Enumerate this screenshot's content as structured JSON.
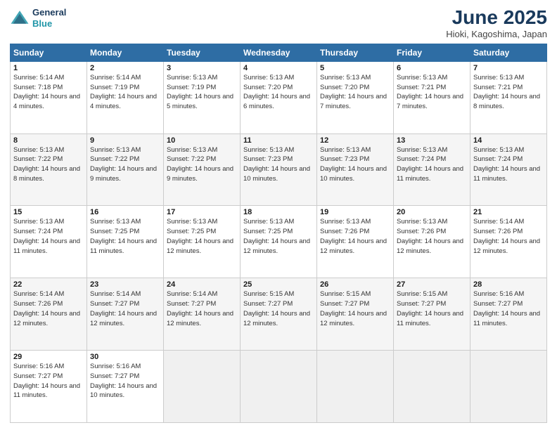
{
  "header": {
    "logo_line1": "General",
    "logo_line2": "Blue",
    "title": "June 2025",
    "location": "Hioki, Kagoshima, Japan"
  },
  "weekdays": [
    "Sunday",
    "Monday",
    "Tuesday",
    "Wednesday",
    "Thursday",
    "Friday",
    "Saturday"
  ],
  "weeks": [
    [
      {
        "day": "1",
        "sunrise": "Sunrise: 5:14 AM",
        "sunset": "Sunset: 7:18 PM",
        "daylight": "Daylight: 14 hours and 4 minutes."
      },
      {
        "day": "2",
        "sunrise": "Sunrise: 5:14 AM",
        "sunset": "Sunset: 7:19 PM",
        "daylight": "Daylight: 14 hours and 4 minutes."
      },
      {
        "day": "3",
        "sunrise": "Sunrise: 5:13 AM",
        "sunset": "Sunset: 7:19 PM",
        "daylight": "Daylight: 14 hours and 5 minutes."
      },
      {
        "day": "4",
        "sunrise": "Sunrise: 5:13 AM",
        "sunset": "Sunset: 7:20 PM",
        "daylight": "Daylight: 14 hours and 6 minutes."
      },
      {
        "day": "5",
        "sunrise": "Sunrise: 5:13 AM",
        "sunset": "Sunset: 7:20 PM",
        "daylight": "Daylight: 14 hours and 7 minutes."
      },
      {
        "day": "6",
        "sunrise": "Sunrise: 5:13 AM",
        "sunset": "Sunset: 7:21 PM",
        "daylight": "Daylight: 14 hours and 7 minutes."
      },
      {
        "day": "7",
        "sunrise": "Sunrise: 5:13 AM",
        "sunset": "Sunset: 7:21 PM",
        "daylight": "Daylight: 14 hours and 8 minutes."
      }
    ],
    [
      {
        "day": "8",
        "sunrise": "Sunrise: 5:13 AM",
        "sunset": "Sunset: 7:22 PM",
        "daylight": "Daylight: 14 hours and 8 minutes."
      },
      {
        "day": "9",
        "sunrise": "Sunrise: 5:13 AM",
        "sunset": "Sunset: 7:22 PM",
        "daylight": "Daylight: 14 hours and 9 minutes."
      },
      {
        "day": "10",
        "sunrise": "Sunrise: 5:13 AM",
        "sunset": "Sunset: 7:22 PM",
        "daylight": "Daylight: 14 hours and 9 minutes."
      },
      {
        "day": "11",
        "sunrise": "Sunrise: 5:13 AM",
        "sunset": "Sunset: 7:23 PM",
        "daylight": "Daylight: 14 hours and 10 minutes."
      },
      {
        "day": "12",
        "sunrise": "Sunrise: 5:13 AM",
        "sunset": "Sunset: 7:23 PM",
        "daylight": "Daylight: 14 hours and 10 minutes."
      },
      {
        "day": "13",
        "sunrise": "Sunrise: 5:13 AM",
        "sunset": "Sunset: 7:24 PM",
        "daylight": "Daylight: 14 hours and 11 minutes."
      },
      {
        "day": "14",
        "sunrise": "Sunrise: 5:13 AM",
        "sunset": "Sunset: 7:24 PM",
        "daylight": "Daylight: 14 hours and 11 minutes."
      }
    ],
    [
      {
        "day": "15",
        "sunrise": "Sunrise: 5:13 AM",
        "sunset": "Sunset: 7:24 PM",
        "daylight": "Daylight: 14 hours and 11 minutes."
      },
      {
        "day": "16",
        "sunrise": "Sunrise: 5:13 AM",
        "sunset": "Sunset: 7:25 PM",
        "daylight": "Daylight: 14 hours and 11 minutes."
      },
      {
        "day": "17",
        "sunrise": "Sunrise: 5:13 AM",
        "sunset": "Sunset: 7:25 PM",
        "daylight": "Daylight: 14 hours and 12 minutes."
      },
      {
        "day": "18",
        "sunrise": "Sunrise: 5:13 AM",
        "sunset": "Sunset: 7:25 PM",
        "daylight": "Daylight: 14 hours and 12 minutes."
      },
      {
        "day": "19",
        "sunrise": "Sunrise: 5:13 AM",
        "sunset": "Sunset: 7:26 PM",
        "daylight": "Daylight: 14 hours and 12 minutes."
      },
      {
        "day": "20",
        "sunrise": "Sunrise: 5:13 AM",
        "sunset": "Sunset: 7:26 PM",
        "daylight": "Daylight: 14 hours and 12 minutes."
      },
      {
        "day": "21",
        "sunrise": "Sunrise: 5:14 AM",
        "sunset": "Sunset: 7:26 PM",
        "daylight": "Daylight: 14 hours and 12 minutes."
      }
    ],
    [
      {
        "day": "22",
        "sunrise": "Sunrise: 5:14 AM",
        "sunset": "Sunset: 7:26 PM",
        "daylight": "Daylight: 14 hours and 12 minutes."
      },
      {
        "day": "23",
        "sunrise": "Sunrise: 5:14 AM",
        "sunset": "Sunset: 7:27 PM",
        "daylight": "Daylight: 14 hours and 12 minutes."
      },
      {
        "day": "24",
        "sunrise": "Sunrise: 5:14 AM",
        "sunset": "Sunset: 7:27 PM",
        "daylight": "Daylight: 14 hours and 12 minutes."
      },
      {
        "day": "25",
        "sunrise": "Sunrise: 5:15 AM",
        "sunset": "Sunset: 7:27 PM",
        "daylight": "Daylight: 14 hours and 12 minutes."
      },
      {
        "day": "26",
        "sunrise": "Sunrise: 5:15 AM",
        "sunset": "Sunset: 7:27 PM",
        "daylight": "Daylight: 14 hours and 12 minutes."
      },
      {
        "day": "27",
        "sunrise": "Sunrise: 5:15 AM",
        "sunset": "Sunset: 7:27 PM",
        "daylight": "Daylight: 14 hours and 11 minutes."
      },
      {
        "day": "28",
        "sunrise": "Sunrise: 5:16 AM",
        "sunset": "Sunset: 7:27 PM",
        "daylight": "Daylight: 14 hours and 11 minutes."
      }
    ],
    [
      {
        "day": "29",
        "sunrise": "Sunrise: 5:16 AM",
        "sunset": "Sunset: 7:27 PM",
        "daylight": "Daylight: 14 hours and 11 minutes."
      },
      {
        "day": "30",
        "sunrise": "Sunrise: 5:16 AM",
        "sunset": "Sunset: 7:27 PM",
        "daylight": "Daylight: 14 hours and 10 minutes."
      },
      null,
      null,
      null,
      null,
      null
    ]
  ]
}
